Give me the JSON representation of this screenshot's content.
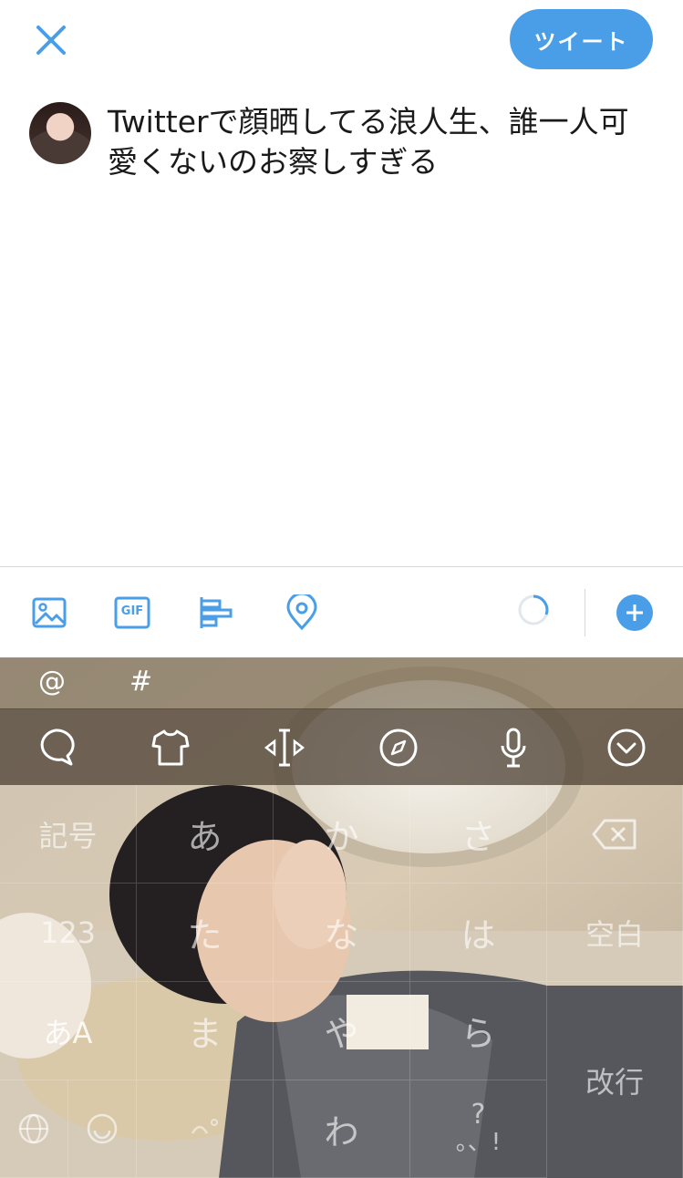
{
  "header": {
    "tweet_button": "ツイート"
  },
  "compose": {
    "text": "Twitterで顔晒してる浪人生、誰一人可愛くないのお察しすぎる"
  },
  "toolbar": {
    "icons": [
      "image-icon",
      "gif-icon",
      "poll-icon",
      "location-icon"
    ],
    "gif_label": "GIF",
    "accent": "#4a9ee8"
  },
  "keyboard": {
    "suggestions": [
      "@",
      "#"
    ],
    "tool_icons": [
      "chat-bubble-icon",
      "shirt-icon",
      "cursor-move-icon",
      "compass-icon",
      "microphone-icon",
      "dismiss-keyboard-icon"
    ],
    "keys": {
      "kigou": "記号",
      "a": "あ",
      "ka": "か",
      "sa": "さ",
      "n123": "123",
      "ta": "た",
      "na": "な",
      "ha": "は",
      "space": "空白",
      "aA": "あA",
      "ma": "ま",
      "ya": "や",
      "ra": "ら",
      "enter": "改行",
      "wa": "わ",
      "punct_top": "?",
      "punct_bottom": "。、!"
    }
  }
}
